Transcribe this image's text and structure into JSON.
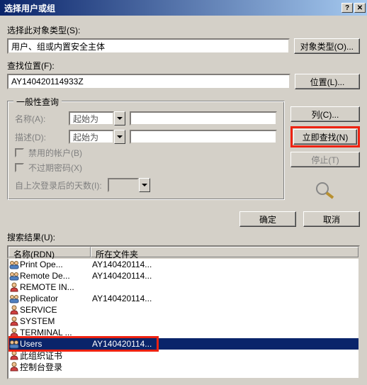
{
  "title": "选择用户或组",
  "objecttype_label": "选择此对象类型(S):",
  "objecttype_value": "用户、组或内置安全主体",
  "objecttype_btn": "对象类型(O)...",
  "location_label": "查找位置(F):",
  "location_value": "AY140420114933Z",
  "location_btn": "位置(L)...",
  "groupbox_title": "一般性查询",
  "name_label": "名称(A):",
  "name_op": "起始为",
  "desc_label": "描述(D):",
  "desc_op": "起始为",
  "disabled_accounts": "禁用的帐户(B)",
  "neverexpire": "不过期密码(X)",
  "dayssince_label": "自上次登录后的天数(I):",
  "columns_btn": "列(C)...",
  "findnow_btn": "立即查找(N)",
  "stop_btn": "停止(T)",
  "ok_btn": "确定",
  "cancel_btn": "取消",
  "results_label": "搜索结果(U):",
  "col_name": "名称(RDN)",
  "col_folder": "所在文件夹",
  "rows": [
    {
      "type": "group",
      "name": "Print Ope...",
      "folder": "AY140420114..."
    },
    {
      "type": "group",
      "name": "Remote De...",
      "folder": "AY140420114..."
    },
    {
      "type": "user",
      "name": "REMOTE IN...",
      "folder": ""
    },
    {
      "type": "group",
      "name": "Replicator",
      "folder": "AY140420114..."
    },
    {
      "type": "user",
      "name": "SERVICE",
      "folder": ""
    },
    {
      "type": "user",
      "name": "SYSTEM",
      "folder": ""
    },
    {
      "type": "user",
      "name": "TERMINAL ...",
      "folder": ""
    },
    {
      "type": "group",
      "name": "Users",
      "folder": "AY140420114...",
      "selected": true
    },
    {
      "type": "user",
      "name": "此组织证书",
      "folder": ""
    },
    {
      "type": "user",
      "name": "控制台登录",
      "folder": ""
    }
  ]
}
